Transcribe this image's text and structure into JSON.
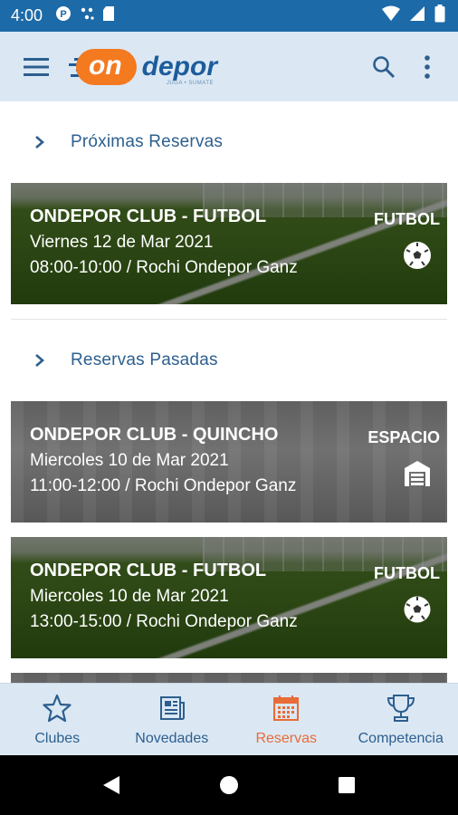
{
  "status_bar": {
    "time": "4:00",
    "icons": [
      "p-badge-icon",
      "signal-dots-icon",
      "sd-card-icon",
      "wifi-icon",
      "cellular-icon",
      "battery-icon"
    ]
  },
  "app_bar": {
    "logo_on": "on",
    "logo_depor": "depor",
    "logo_tagline": "JUGA • SUMATE",
    "actions": [
      "search-icon",
      "more-vert-icon"
    ]
  },
  "sections": {
    "upcoming": {
      "title": "Próximas Reservas"
    },
    "past": {
      "title": "Reservas Pasadas"
    }
  },
  "reservations_upcoming": [
    {
      "title": "ONDEPOR CLUB - FUTBOL",
      "date": "Viernes 12 de Mar 2021",
      "detail": "08:00-10:00 / Rochi Ondepor Ganz",
      "type": "FUTBOL",
      "icon": "soccer-ball-icon"
    }
  ],
  "reservations_past": [
    {
      "title": "ONDEPOR CLUB - QUINCHO",
      "date": "Miercoles 10 de Mar 2021",
      "detail": "11:00-12:00 / Rochi Ondepor Ganz",
      "type": "ESPACIO",
      "icon": "warehouse-icon"
    },
    {
      "title": "ONDEPOR CLUB - FUTBOL",
      "date": "Miercoles 10 de Mar 2021",
      "detail": "13:00-15:00 / Rochi Ondepor Ganz",
      "type": "FUTBOL",
      "icon": "soccer-ball-icon"
    }
  ],
  "bottom_nav": {
    "items": [
      {
        "label": "Clubes",
        "icon": "star-icon"
      },
      {
        "label": "Novedades",
        "icon": "newspaper-icon"
      },
      {
        "label": "Reservas",
        "icon": "calendar-icon",
        "active": true
      },
      {
        "label": "Competencia",
        "icon": "trophy-icon"
      }
    ]
  },
  "colors": {
    "status_bar": "#1d6aa8",
    "app_bar": "#dbe8f4",
    "primary_text": "#2d5f8e",
    "accent_orange": "#e96b38"
  }
}
